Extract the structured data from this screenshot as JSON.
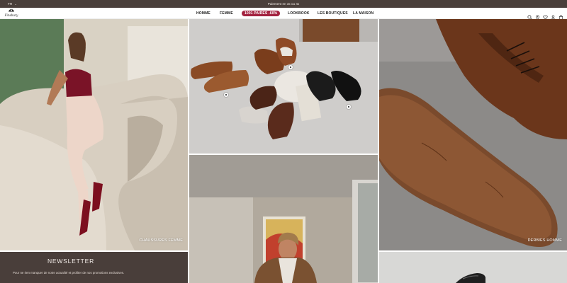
{
  "topbar": {
    "language": "FR",
    "promo": "Paiement en 3x ou 4x"
  },
  "brand": {
    "name": "Finsbury"
  },
  "nav": [
    {
      "label": "HOMME"
    },
    {
      "label": "FEMME"
    },
    {
      "label": "1001 PAIRES -60%"
    },
    {
      "label": "LOOKBOOK"
    },
    {
      "label": "LES BOUTIQUES"
    },
    {
      "label": "LA MAISON"
    }
  ],
  "header_icons": [
    "search-icon",
    "store-locator-icon",
    "wishlist-icon",
    "account-icon",
    "bag-icon"
  ],
  "tiles": {
    "femme": {
      "caption": "CHAUSSURES FEMME"
    },
    "derbies": {
      "caption": "DERBIES HOMME"
    }
  },
  "newsletter": {
    "title": "NEWSLETTER",
    "description": "Pour ne rien manquer de notre actualité et profiter de nos promotions exclusives."
  },
  "colors": {
    "topbar": "#4a3f3b",
    "promo_pill": "#a3223f",
    "newsletter_bg": "#493e3a"
  }
}
